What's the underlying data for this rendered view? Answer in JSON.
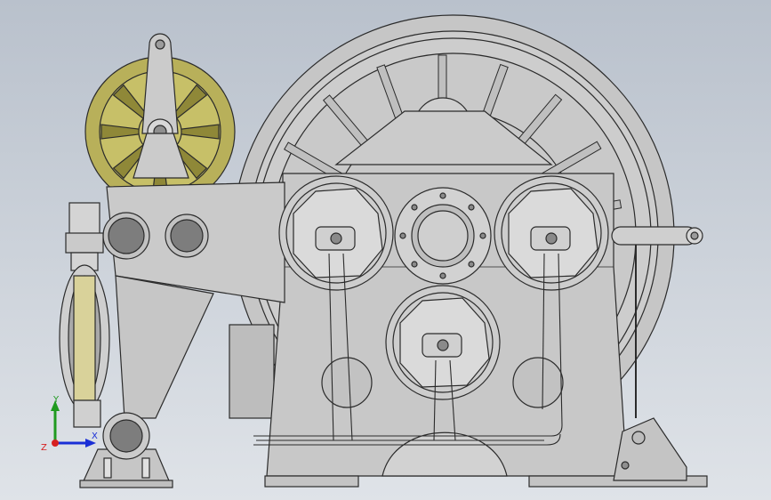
{
  "viewport": {
    "background_top": "#b9c1cc",
    "background_bottom": "#dfe3e8"
  },
  "colors": {
    "steel": "#c9c9c9",
    "steel_dark": "#a9a9a9",
    "steel_light": "#dedede",
    "outline": "#2b2b2b",
    "pulley_yellow": "#b8b05a",
    "pulley_yellow_dark": "#8f8838",
    "bore_dark": "#7d7d7d",
    "pipe": "#d7d7d7"
  },
  "triad": {
    "x_label": "X",
    "y_label": "Y",
    "z_label": "Z",
    "x_color": "#1a2fd6",
    "y_color": "#1f9a1f",
    "z_color": "#d62020"
  },
  "icons": {
    "axis_triad": "coordinate-triad-icon"
  }
}
